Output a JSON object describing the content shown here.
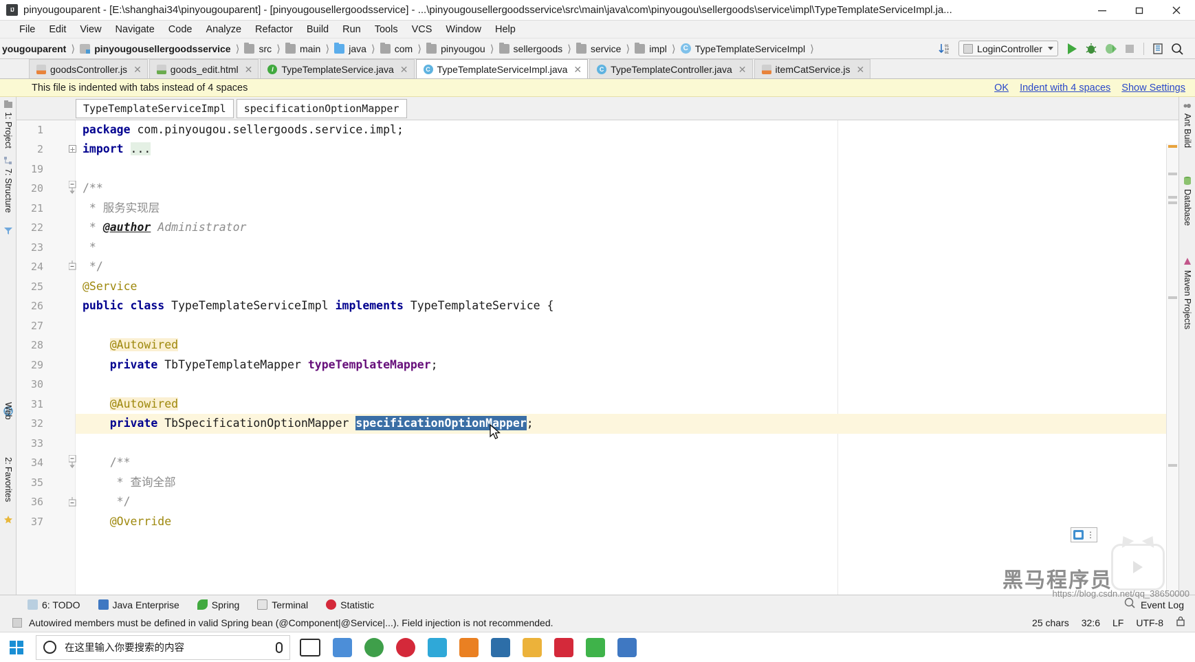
{
  "window": {
    "title": "pinyougouparent - [E:\\shanghai34\\pinyougouparent] - [pinyougousellergoodsservice] - ...\\pinyougousellergoodsservice\\src\\main\\java\\com\\pinyougou\\sellergoods\\service\\impl\\TypeTemplateServiceImpl.ja...",
    "app_icon": "intellij-idea-icon",
    "minimize": "minimize-icon",
    "maximize": "maximize-icon",
    "close": "close-icon"
  },
  "menubar": {
    "items": [
      {
        "label": "File",
        "mnemonic": "F"
      },
      {
        "label": "Edit",
        "mnemonic": "E"
      },
      {
        "label": "View",
        "mnemonic": "V"
      },
      {
        "label": "Navigate",
        "mnemonic": "N"
      },
      {
        "label": "Code",
        "mnemonic": "C"
      },
      {
        "label": "Analyze",
        "mnemonic": ""
      },
      {
        "label": "Refactor",
        "mnemonic": "R"
      },
      {
        "label": "Build",
        "mnemonic": "B"
      },
      {
        "label": "Run",
        "mnemonic": "u"
      },
      {
        "label": "Tools",
        "mnemonic": "T"
      },
      {
        "label": "VCS",
        "mnemonic": "S"
      },
      {
        "label": "Window",
        "mnemonic": "W"
      },
      {
        "label": "Help",
        "mnemonic": "H"
      }
    ]
  },
  "navbar": {
    "crumbs": [
      {
        "label": "yougouparent",
        "icon": "none",
        "bold": true
      },
      {
        "label": "pinyougousellergoodsservice",
        "icon": "module-icon",
        "bold": true
      },
      {
        "label": "src",
        "icon": "folder-icon",
        "bold": false
      },
      {
        "label": "main",
        "icon": "folder-icon",
        "bold": false
      },
      {
        "label": "java",
        "icon": "source-folder-icon",
        "bold": false
      },
      {
        "label": "com",
        "icon": "folder-icon",
        "bold": false
      },
      {
        "label": "pinyougou",
        "icon": "folder-icon",
        "bold": false
      },
      {
        "label": "sellergoods",
        "icon": "folder-icon",
        "bold": false
      },
      {
        "label": "service",
        "icon": "folder-icon",
        "bold": false
      },
      {
        "label": "impl",
        "icon": "folder-icon",
        "bold": false
      },
      {
        "label": "TypeTemplateServiceImpl",
        "icon": "java-class-icon",
        "bold": false
      }
    ],
    "separator": "〉",
    "sort_icon": "sort-numeric-icon",
    "run_config": "LoginController",
    "buttons": [
      {
        "name": "run-button",
        "icon": "run-triangle-icon"
      },
      {
        "name": "debug-button",
        "icon": "debug-bug-icon"
      },
      {
        "name": "run-with-coverage-button",
        "icon": "coverage-icon"
      },
      {
        "name": "stop-button",
        "icon": "stop-square-icon"
      },
      {
        "name": "database-button",
        "icon": "database-icon"
      },
      {
        "name": "search-everywhere-button",
        "icon": "search-icon"
      }
    ]
  },
  "tabs": [
    {
      "label": "goodsController.js",
      "icon": "js-file-icon",
      "active": false
    },
    {
      "label": "goods_edit.html",
      "icon": "html-file-icon",
      "active": false
    },
    {
      "label": "TypeTemplateService.java",
      "icon": "java-interface-icon",
      "active": false
    },
    {
      "label": "TypeTemplateServiceImpl.java",
      "icon": "java-class-icon",
      "active": true
    },
    {
      "label": "TypeTemplateController.java",
      "icon": "java-class-icon",
      "active": false
    },
    {
      "label": "itemCatService.js",
      "icon": "js-file-icon",
      "active": false
    }
  ],
  "banner": {
    "message": "This file is indented with tabs instead of 4 spaces",
    "links": [
      "OK",
      "Indent with 4 spaces",
      "Show Settings"
    ]
  },
  "editor_breadcrumb": [
    "TypeTemplateServiceImpl",
    "specificationOptionMapper"
  ],
  "code": {
    "lines": [
      {
        "num": "1",
        "fold": "",
        "text": "package com.pinyougou.sellergoods.service.impl;"
      },
      {
        "num": "2",
        "fold": "plus",
        "text": "import ..."
      },
      {
        "num": "19",
        "fold": "",
        "text": ""
      },
      {
        "num": "20",
        "fold": "minus-top",
        "text": "/**"
      },
      {
        "num": "21",
        "fold": "",
        "text": " * 服务实现层"
      },
      {
        "num": "22",
        "fold": "",
        "text": " * @author Administrator"
      },
      {
        "num": "23",
        "fold": "",
        "text": " *"
      },
      {
        "num": "24",
        "fold": "minus-bottom",
        "text": " */"
      },
      {
        "num": "25",
        "fold": "",
        "text": "@Service"
      },
      {
        "num": "26",
        "fold": "",
        "text": "public class TypeTemplateServiceImpl implements TypeTemplateService {"
      },
      {
        "num": "27",
        "fold": "",
        "text": ""
      },
      {
        "num": "28",
        "fold": "",
        "text": "    @Autowired"
      },
      {
        "num": "29",
        "fold": "",
        "text": "    private TbTypeTemplateMapper typeTemplateMapper;"
      },
      {
        "num": "30",
        "fold": "",
        "text": ""
      },
      {
        "num": "31",
        "fold": "",
        "text": "    @Autowired"
      },
      {
        "num": "32",
        "fold": "",
        "text": "    private TbSpecificationOptionMapper specificationOptionMapper;"
      },
      {
        "num": "33",
        "fold": "",
        "text": ""
      },
      {
        "num": "34",
        "fold": "minus-top",
        "text": "    /**"
      },
      {
        "num": "35",
        "fold": "",
        "text": "     * 查询全部"
      },
      {
        "num": "36",
        "fold": "minus-bottom",
        "text": "     */"
      },
      {
        "num": "37",
        "fold": "",
        "text": "    @Override"
      }
    ],
    "selection": "specificationOptionMapper"
  },
  "left_strip": {
    "items": [
      {
        "label": "1: Project",
        "icon": "project-icon"
      },
      {
        "label": "7: Structure",
        "icon": "structure-icon"
      },
      {
        "label": "Web",
        "icon": "web-icon"
      },
      {
        "label": "2: Favorites",
        "icon": "favorites-star-icon"
      }
    ]
  },
  "right_strip": {
    "items": [
      {
        "label": "Ant Build",
        "icon": "ant-icon"
      },
      {
        "label": "Database",
        "icon": "database-icon"
      },
      {
        "label": "Maven Projects",
        "icon": "maven-icon"
      }
    ]
  },
  "bottom_bar": {
    "items": [
      {
        "label": "6: TODO",
        "icon": "todo-icon",
        "mnemonic": "6"
      },
      {
        "label": "Java Enterprise",
        "icon": "java-enterprise-icon",
        "mnemonic": ""
      },
      {
        "label": "Spring",
        "icon": "spring-leaf-icon",
        "mnemonic": ""
      },
      {
        "label": "Terminal",
        "icon": "terminal-icon",
        "mnemonic": ""
      },
      {
        "label": "Statistic",
        "icon": "statistic-icon",
        "mnemonic": ""
      }
    ],
    "event_log": "Event Log",
    "event_log_icon": "event-log-icon"
  },
  "statusbar": {
    "message": "Autowired members must be defined in valid Spring bean (@Component|@Service|...). Field injection is not recommended.",
    "position": "32:6",
    "selection_info": "25 chars",
    "line_sep": "LF",
    "encoding": "UTF-8",
    "lock_icon": "lock-icon"
  },
  "taskbar": {
    "start_icon": "windows-start-icon",
    "search_placeholder": "在这里输入你要搜索的内容",
    "search_icon": "search-icon",
    "mic_icon": "microphone-icon",
    "task_view_icon": "task-view-icon",
    "apps": [
      {
        "name": "app-firefox",
        "color": "#4c8ed8"
      },
      {
        "name": "app-chrome",
        "color": "#3f9f4a"
      },
      {
        "name": "app-opera",
        "color": "#d4293a"
      },
      {
        "name": "app-qq-browser",
        "color": "#2fa8d8"
      },
      {
        "name": "app-explorer-orange",
        "color": "#ea8022"
      },
      {
        "name": "app-intellij-idea",
        "color": "#2d6ea8"
      },
      {
        "name": "app-file-explorer",
        "color": "#ecb23a"
      },
      {
        "name": "app-pdf",
        "color": "#d4293a"
      },
      {
        "name": "app-wechat",
        "color": "#3fb34a"
      },
      {
        "name": "app-editor",
        "color": "#3f78c2"
      }
    ]
  },
  "watermark": {
    "url": "https://blog.csdn.net/qq_38650000",
    "brand": "黑马程序员"
  },
  "colors": {
    "accent_blue": "#2a48c9",
    "selection_blue": "#3a6ea5",
    "banner_yellow": "#fbf9d3",
    "keyword": "#00008f",
    "annotation": "#9e880d",
    "field_purple": "#660e7a",
    "comment_gray": "#8c8c8c",
    "run_green": "#41a93f"
  }
}
